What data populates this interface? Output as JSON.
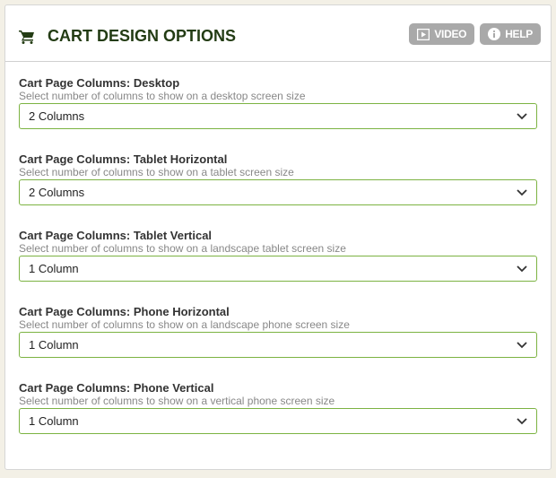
{
  "header": {
    "title": "CART DESIGN OPTIONS",
    "video_label": "VIDEO",
    "help_label": "HELP"
  },
  "fields": [
    {
      "label": "Cart Page Columns: Desktop",
      "description": "Select number of columns to show on a desktop screen size",
      "value": "2 Columns"
    },
    {
      "label": "Cart Page Columns: Tablet Horizontal",
      "description": "Select number of columns to show on a tablet screen size",
      "value": "2 Columns"
    },
    {
      "label": "Cart Page Columns: Tablet Vertical",
      "description": "Select number of columns to show on a landscape tablet screen size",
      "value": "1 Column"
    },
    {
      "label": "Cart Page Columns: Phone Horizontal",
      "description": "Select number of columns to show on a landscape phone screen size",
      "value": "1 Column"
    },
    {
      "label": "Cart Page Columns: Phone Vertical",
      "description": "Select number of columns to show on a vertical phone screen size",
      "value": "1 Column"
    }
  ]
}
